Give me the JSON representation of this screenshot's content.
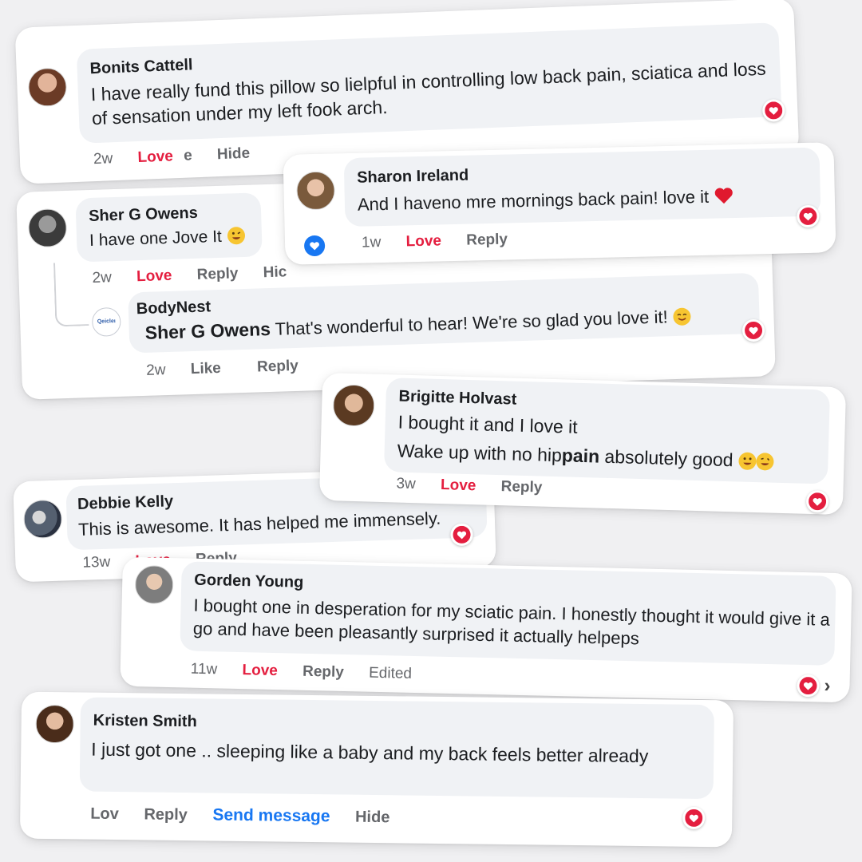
{
  "comments": [
    {
      "name": "Bonits Cattell",
      "text": "I have really fund this pillow so lielpful in controlling low back pain, sciatica and loss of sensation under my left fook arch.",
      "time": "2w",
      "love": "Love",
      "extra": "e",
      "hide": "Hide"
    },
    {
      "name": "Sher G Owens",
      "text": "I have one Jove It",
      "time": "2w",
      "love": "Love",
      "reply": "Reply",
      "hide": "Hic"
    },
    {
      "name": "BodyNest",
      "avatar_text": "Qeicleı",
      "tag": "Sher G Owens",
      "text": " That's wonderful to hear! We're so glad you love it!",
      "time": "2w",
      "like": "Like",
      "reply": "Reply"
    },
    {
      "name": "Sharon Ireland",
      "text": "And I haveno mre mornings back pain! love it",
      "time": "1w",
      "love": "Love",
      "reply": "Reply"
    },
    {
      "name": "Brigitte Holvast",
      "line1": "I bought it and I love it",
      "line2_pre": "Wake up with no hip",
      "line2_bold": "pain",
      "line2_post": " absolutely good",
      "time": "3w",
      "love": "Love",
      "reply": "Reply"
    },
    {
      "name": "Debbie Kelly",
      "text": "This is awesome. It has helped me immensely.",
      "time": "13w",
      "love": "Love",
      "reply": "Reply"
    },
    {
      "name": "Gorden Young",
      "text": "I bought one in desperation for my sciatic pain. I honestly thought it would give it a go and have been pleasantly surprised it actually helpeps",
      "time": "11w",
      "love": "Love",
      "reply": "Reply",
      "edited": "Edited"
    },
    {
      "name": "Kristen Smith",
      "text": "I just got one .. sleeping like a baby and my back feels better already",
      "love": "Lov",
      "reply": "Reply",
      "send": "Send message",
      "hide": "Hide"
    }
  ],
  "colors": {
    "love": "#e41e3f",
    "link": "#1877f2",
    "bubble": "#f0f2f5"
  },
  "icons": [
    "heart-reaction-icon",
    "like-reaction-icon",
    "chevron-right-icon",
    "smile-emoji-icon",
    "heart-emoji-icon"
  ]
}
